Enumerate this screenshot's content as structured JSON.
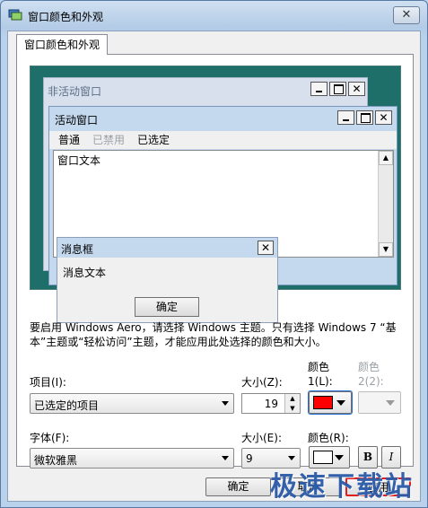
{
  "window": {
    "title": "窗口颜色和外观",
    "close_label": "✕"
  },
  "tab": {
    "label": "窗口颜色和外观"
  },
  "preview": {
    "inactive_title": "非活动窗口",
    "active_title": "活动窗口",
    "menu": [
      "普通",
      "已禁用",
      "已选定"
    ],
    "window_text": "窗口文本",
    "msgbox_title": "消息框",
    "msgbox_text": "消息文本",
    "msgbox_ok": "确定",
    "caption_min": "",
    "caption_max": "",
    "caption_close": "✕"
  },
  "description": "要启用 Windows Aero，请选择 Windows 主题。只有选择 Windows 7 “基本”主题或“轻松访问”主题，才能应用此处选择的颜色和大小。",
  "item": {
    "label": "项目(I):",
    "value": "已选定的项目"
  },
  "size1": {
    "label": "大小(Z):",
    "value": "19"
  },
  "color1": {
    "label": "颜色 1(L):",
    "color": "#ff0000"
  },
  "color2": {
    "label": "颜色 2(2):"
  },
  "font": {
    "label": "字体(F):",
    "value": "微软雅黑"
  },
  "size2": {
    "label": "大小(E):",
    "value": "9"
  },
  "fontcolor": {
    "label": "颜色(R):",
    "color": "#ffffff"
  },
  "bold_label": "B",
  "italic_label": "I",
  "buttons": {
    "ok": "确定",
    "cancel": "取消",
    "apply": "应用"
  },
  "watermark": "极速下载站",
  "colors": {
    "preview_bg": "#1e6e6a",
    "active_caption": "#c4d8ee",
    "inactive_caption": "#d7e0ec"
  }
}
